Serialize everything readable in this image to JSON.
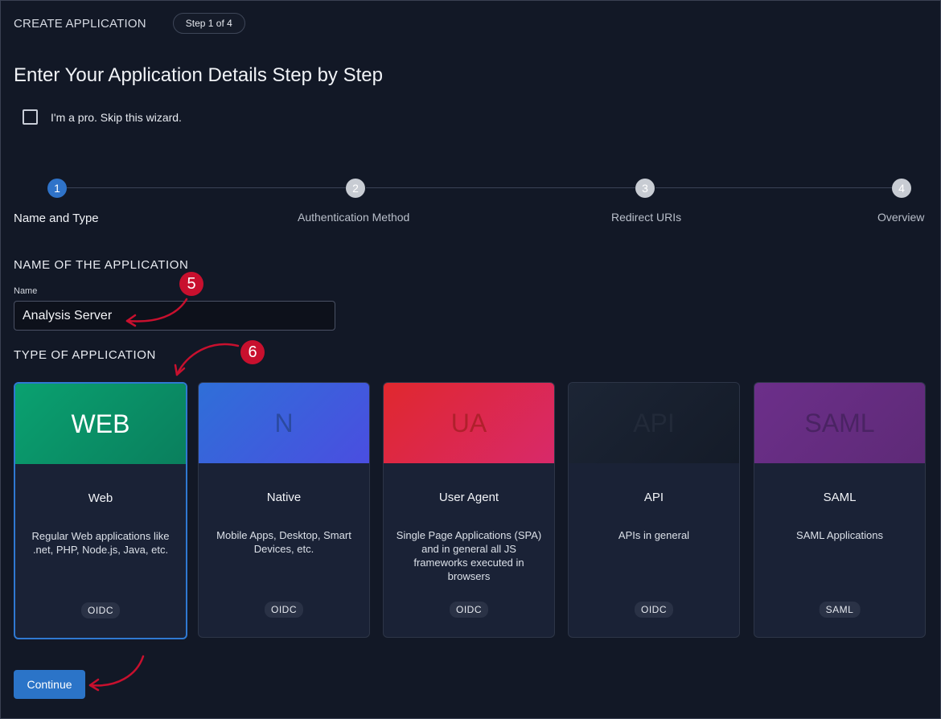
{
  "header": {
    "title": "CREATE APPLICATION",
    "step_pill": "Step 1 of 4"
  },
  "page": {
    "title": "Enter Your Application Details Step by Step"
  },
  "skip_wizard": {
    "label": "I'm a pro. Skip this wizard.",
    "checked": false
  },
  "stepper": {
    "steps": [
      {
        "number": "1",
        "label": "Name and Type",
        "active": true
      },
      {
        "number": "2",
        "label": "Authentication Method",
        "active": false
      },
      {
        "number": "3",
        "label": "Redirect URIs",
        "active": false
      },
      {
        "number": "4",
        "label": "Overview",
        "active": false
      }
    ]
  },
  "name_section": {
    "title": "NAME OF THE APPLICATION",
    "field_label": "Name",
    "value": "Analysis Server"
  },
  "type_section": {
    "title": "TYPE OF APPLICATION"
  },
  "annotations": {
    "callout_5": "5",
    "callout_6": "6",
    "color": "#c8102e"
  },
  "cards": [
    {
      "banner": "WEB",
      "title": "Web",
      "description": "Regular Web applications like .net, PHP, Node.js, Java, etc.",
      "badge": "OIDC",
      "selected": true
    },
    {
      "banner": "N",
      "title": "Native",
      "description": "Mobile Apps, Desktop, Smart Devices, etc.",
      "badge": "OIDC",
      "selected": false
    },
    {
      "banner": "UA",
      "title": "User Agent",
      "description": "Single Page Applications (SPA) and in general all JS frameworks executed in browsers",
      "badge": "OIDC",
      "selected": false
    },
    {
      "banner": "API",
      "title": "API",
      "description": "APIs in general",
      "badge": "OIDC",
      "selected": false
    },
    {
      "banner": "SAML",
      "title": "SAML",
      "description": "SAML Applications",
      "badge": "SAML",
      "selected": false
    }
  ],
  "actions": {
    "continue_label": "Continue"
  },
  "colors": {
    "accent": "#2b74c8",
    "background": "#121826",
    "card": "#1a2236"
  }
}
